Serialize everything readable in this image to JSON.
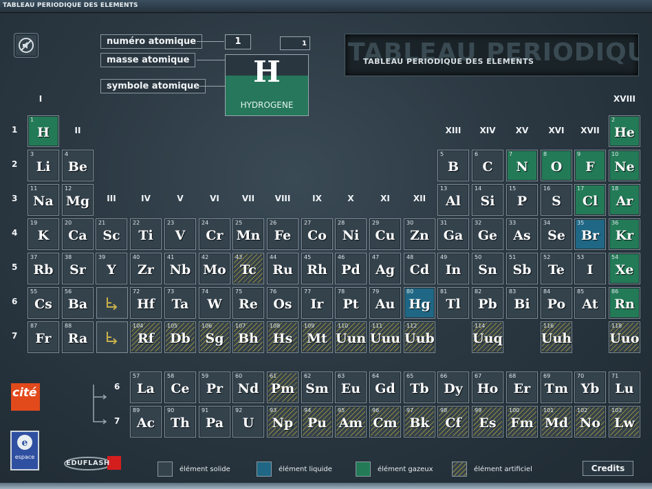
{
  "window": {
    "title": "TABLEAU PERIODIQUE DES ELEMENTS"
  },
  "banner": {
    "text": "TABLEAU PERIODIQUE DES ELEMENTS",
    "ghost_text": "TABLEAU PERIODIQUE DES ELEMENTS"
  },
  "legend_key": {
    "atomic_number_label": "numéro atomique",
    "atomic_mass_label": "masse atomique",
    "symbol_label": "symbole atomique",
    "sample": {
      "number": "1",
      "mass": "1",
      "symbol": "H",
      "name": "HYDROGENE"
    }
  },
  "groups": [
    "I",
    "II",
    "III",
    "IV",
    "V",
    "VI",
    "VII",
    "VIII",
    "IX",
    "X",
    "XI",
    "XII",
    "XIII",
    "XIV",
    "XV",
    "XVI",
    "XVII",
    "XVIII"
  ],
  "periods": [
    "1",
    "2",
    "3",
    "4",
    "5",
    "6",
    "7"
  ],
  "series_periods": [
    "6",
    "7"
  ],
  "elements": [
    {
      "n": "1",
      "s": "H",
      "state": "gas"
    },
    {
      "n": "2",
      "s": "He",
      "state": "gas"
    },
    {
      "n": "3",
      "s": "Li",
      "state": "solid"
    },
    {
      "n": "4",
      "s": "Be",
      "state": "solid"
    },
    {
      "n": "5",
      "s": "B",
      "state": "solid"
    },
    {
      "n": "6",
      "s": "C",
      "state": "solid"
    },
    {
      "n": "7",
      "s": "N",
      "state": "gas"
    },
    {
      "n": "8",
      "s": "O",
      "state": "gas"
    },
    {
      "n": "9",
      "s": "F",
      "state": "gas"
    },
    {
      "n": "10",
      "s": "Ne",
      "state": "gas"
    },
    {
      "n": "11",
      "s": "Na",
      "state": "solid"
    },
    {
      "n": "12",
      "s": "Mg",
      "state": "solid"
    },
    {
      "n": "13",
      "s": "Al",
      "state": "solid"
    },
    {
      "n": "14",
      "s": "Si",
      "state": "solid"
    },
    {
      "n": "15",
      "s": "P",
      "state": "solid"
    },
    {
      "n": "16",
      "s": "S",
      "state": "solid"
    },
    {
      "n": "17",
      "s": "Cl",
      "state": "gas"
    },
    {
      "n": "18",
      "s": "Ar",
      "state": "gas"
    },
    {
      "n": "19",
      "s": "K",
      "state": "solid"
    },
    {
      "n": "20",
      "s": "Ca",
      "state": "solid"
    },
    {
      "n": "21",
      "s": "Sc",
      "state": "solid"
    },
    {
      "n": "22",
      "s": "Ti",
      "state": "solid"
    },
    {
      "n": "23",
      "s": "V",
      "state": "solid"
    },
    {
      "n": "24",
      "s": "Cr",
      "state": "solid"
    },
    {
      "n": "25",
      "s": "Mn",
      "state": "solid"
    },
    {
      "n": "26",
      "s": "Fe",
      "state": "solid"
    },
    {
      "n": "27",
      "s": "Co",
      "state": "solid"
    },
    {
      "n": "28",
      "s": "Ni",
      "state": "solid"
    },
    {
      "n": "29",
      "s": "Cu",
      "state": "solid"
    },
    {
      "n": "30",
      "s": "Zn",
      "state": "solid"
    },
    {
      "n": "31",
      "s": "Ga",
      "state": "solid"
    },
    {
      "n": "32",
      "s": "Ge",
      "state": "solid"
    },
    {
      "n": "33",
      "s": "As",
      "state": "solid"
    },
    {
      "n": "34",
      "s": "Se",
      "state": "solid"
    },
    {
      "n": "35",
      "s": "Br",
      "state": "liquid"
    },
    {
      "n": "36",
      "s": "Kr",
      "state": "gas"
    },
    {
      "n": "37",
      "s": "Rb",
      "state": "solid"
    },
    {
      "n": "38",
      "s": "Sr",
      "state": "solid"
    },
    {
      "n": "39",
      "s": "Y",
      "state": "solid"
    },
    {
      "n": "40",
      "s": "Zr",
      "state": "solid"
    },
    {
      "n": "41",
      "s": "Nb",
      "state": "solid"
    },
    {
      "n": "42",
      "s": "Mo",
      "state": "solid"
    },
    {
      "n": "43",
      "s": "Tc",
      "state": "art"
    },
    {
      "n": "44",
      "s": "Ru",
      "state": "solid"
    },
    {
      "n": "45",
      "s": "Rh",
      "state": "solid"
    },
    {
      "n": "46",
      "s": "Pd",
      "state": "solid"
    },
    {
      "n": "47",
      "s": "Ag",
      "state": "solid"
    },
    {
      "n": "48",
      "s": "Cd",
      "state": "solid"
    },
    {
      "n": "49",
      "s": "In",
      "state": "solid"
    },
    {
      "n": "50",
      "s": "Sn",
      "state": "solid"
    },
    {
      "n": "51",
      "s": "Sb",
      "state": "solid"
    },
    {
      "n": "52",
      "s": "Te",
      "state": "solid"
    },
    {
      "n": "53",
      "s": "I",
      "state": "solid"
    },
    {
      "n": "54",
      "s": "Xe",
      "state": "gas"
    },
    {
      "n": "55",
      "s": "Cs",
      "state": "solid"
    },
    {
      "n": "56",
      "s": "Ba",
      "state": "solid"
    },
    {
      "n": "72",
      "s": "Hf",
      "state": "solid"
    },
    {
      "n": "73",
      "s": "Ta",
      "state": "solid"
    },
    {
      "n": "74",
      "s": "W",
      "state": "solid"
    },
    {
      "n": "75",
      "s": "Re",
      "state": "solid"
    },
    {
      "n": "76",
      "s": "Os",
      "state": "solid"
    },
    {
      "n": "77",
      "s": "Ir",
      "state": "solid"
    },
    {
      "n": "78",
      "s": "Pt",
      "state": "solid"
    },
    {
      "n": "79",
      "s": "Au",
      "state": "solid"
    },
    {
      "n": "80",
      "s": "Hg",
      "state": "liquid"
    },
    {
      "n": "81",
      "s": "Tl",
      "state": "solid"
    },
    {
      "n": "82",
      "s": "Pb",
      "state": "solid"
    },
    {
      "n": "83",
      "s": "Bi",
      "state": "solid"
    },
    {
      "n": "84",
      "s": "Po",
      "state": "solid"
    },
    {
      "n": "85",
      "s": "At",
      "state": "solid"
    },
    {
      "n": "86",
      "s": "Rn",
      "state": "gas"
    },
    {
      "n": "87",
      "s": "Fr",
      "state": "solid"
    },
    {
      "n": "88",
      "s": "Ra",
      "state": "solid"
    },
    {
      "n": "104",
      "s": "Rf",
      "state": "art"
    },
    {
      "n": "105",
      "s": "Db",
      "state": "art"
    },
    {
      "n": "106",
      "s": "Sg",
      "state": "art"
    },
    {
      "n": "107",
      "s": "Bh",
      "state": "art"
    },
    {
      "n": "108",
      "s": "Hs",
      "state": "art"
    },
    {
      "n": "109",
      "s": "Mt",
      "state": "art"
    },
    {
      "n": "110",
      "s": "Uun",
      "state": "art"
    },
    {
      "n": "111",
      "s": "Uuu",
      "state": "art"
    },
    {
      "n": "112",
      "s": "Uub",
      "state": "art"
    },
    {
      "n": "114",
      "s": "Uuq",
      "state": "art"
    },
    {
      "n": "116",
      "s": "Uuh",
      "state": "art"
    },
    {
      "n": "118",
      "s": "Uuo",
      "state": "art"
    },
    {
      "n": "57",
      "s": "La",
      "state": "solid"
    },
    {
      "n": "58",
      "s": "Ce",
      "state": "solid"
    },
    {
      "n": "59",
      "s": "Pr",
      "state": "solid"
    },
    {
      "n": "60",
      "s": "Nd",
      "state": "solid"
    },
    {
      "n": "61",
      "s": "Pm",
      "state": "art"
    },
    {
      "n": "62",
      "s": "Sm",
      "state": "solid"
    },
    {
      "n": "63",
      "s": "Eu",
      "state": "solid"
    },
    {
      "n": "64",
      "s": "Gd",
      "state": "solid"
    },
    {
      "n": "65",
      "s": "Tb",
      "state": "solid"
    },
    {
      "n": "66",
      "s": "Dy",
      "state": "solid"
    },
    {
      "n": "67",
      "s": "Ho",
      "state": "solid"
    },
    {
      "n": "68",
      "s": "Er",
      "state": "solid"
    },
    {
      "n": "69",
      "s": "Tm",
      "state": "solid"
    },
    {
      "n": "70",
      "s": "Yb",
      "state": "solid"
    },
    {
      "n": "71",
      "s": "Lu",
      "state": "solid"
    },
    {
      "n": "89",
      "s": "Ac",
      "state": "solid"
    },
    {
      "n": "90",
      "s": "Th",
      "state": "solid"
    },
    {
      "n": "91",
      "s": "Pa",
      "state": "solid"
    },
    {
      "n": "92",
      "s": "U",
      "state": "solid"
    },
    {
      "n": "93",
      "s": "Np",
      "state": "art"
    },
    {
      "n": "94",
      "s": "Pu",
      "state": "art"
    },
    {
      "n": "95",
      "s": "Am",
      "state": "art"
    },
    {
      "n": "96",
      "s": "Cm",
      "state": "art"
    },
    {
      "n": "97",
      "s": "Bk",
      "state": "art"
    },
    {
      "n": "98",
      "s": "Cf",
      "state": "art"
    },
    {
      "n": "99",
      "s": "Es",
      "state": "art"
    },
    {
      "n": "100",
      "s": "Fm",
      "state": "art"
    },
    {
      "n": "101",
      "s": "Md",
      "state": "art"
    },
    {
      "n": "102",
      "s": "No",
      "state": "art"
    },
    {
      "n": "103",
      "s": "Lw",
      "state": "art"
    }
  ],
  "state_legend": {
    "solid": "élément solide",
    "liquid": "élément liquide",
    "gas": "élément gazeux",
    "art": "élément artificiel"
  },
  "colors": {
    "solid": "#34424c",
    "liquid": "#1f6784",
    "gas": "#237a57",
    "artificial_hatch": "#bea a3c"
  },
  "credits_label": "Credits",
  "logos": {
    "cite": "cité",
    "espace": "espace",
    "educ": "EDUFLASH"
  },
  "icons": {
    "sound": "sound-off-icon",
    "ref_arrow": "bracket-arrow-icon"
  }
}
